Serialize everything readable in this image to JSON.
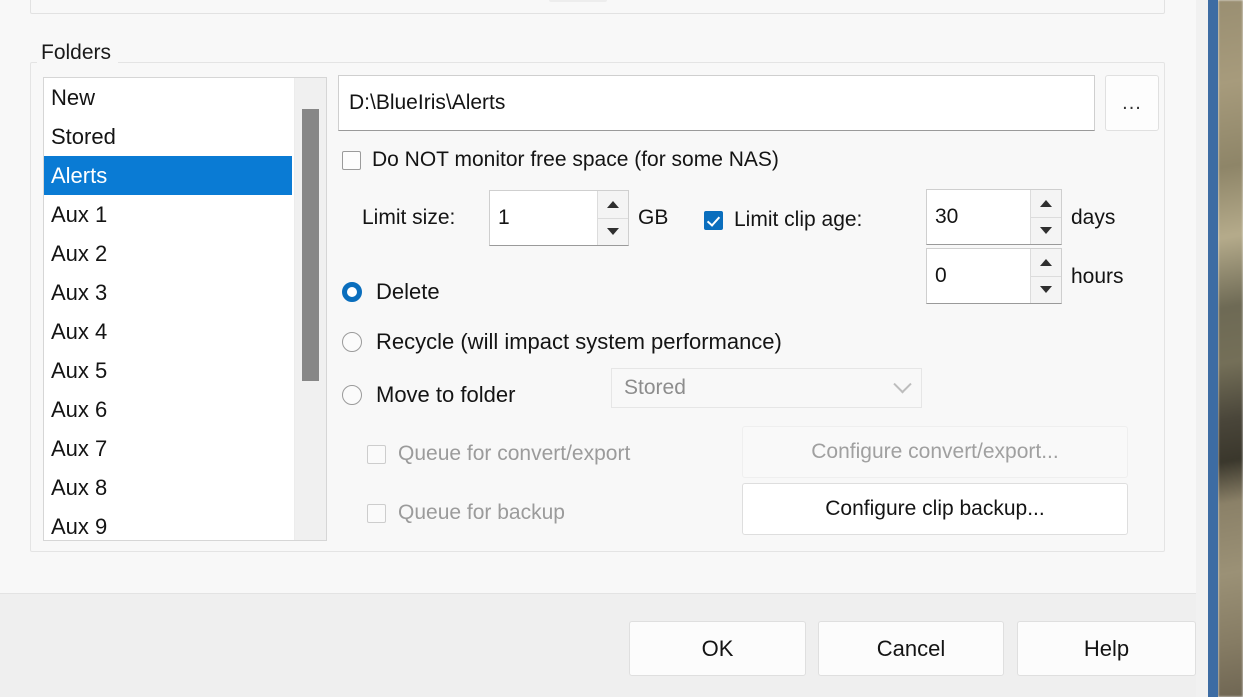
{
  "dialog": {
    "folders_group_label": "Folders"
  },
  "folder_list": {
    "items": [
      {
        "label": "New",
        "selected": false
      },
      {
        "label": "Stored",
        "selected": false
      },
      {
        "label": "Alerts",
        "selected": true
      },
      {
        "label": "Aux 1",
        "selected": false
      },
      {
        "label": "Aux 2",
        "selected": false
      },
      {
        "label": "Aux 3",
        "selected": false
      },
      {
        "label": "Aux 4",
        "selected": false
      },
      {
        "label": "Aux 5",
        "selected": false
      },
      {
        "label": "Aux 6",
        "selected": false
      },
      {
        "label": "Aux 7",
        "selected": false
      },
      {
        "label": "Aux 8",
        "selected": false
      },
      {
        "label": "Aux 9",
        "selected": false
      }
    ],
    "selected_value": "Alerts",
    "selection_color": "#0a7bd4",
    "scrollbar_thumb_color": "#878787"
  },
  "path": {
    "value": "D:\\BlueIris\\Alerts",
    "placeholder": "",
    "browse_label": "..."
  },
  "options": {
    "no_monitor_free_space": {
      "label": "Do NOT monitor free space (for some NAS)",
      "checked": false
    },
    "limit_size": {
      "label": "Limit size:",
      "value": "1",
      "unit": "GB"
    },
    "limit_clip_age": {
      "label": "Limit clip age:",
      "checked": true,
      "days_value": "30",
      "days_unit": "days",
      "hours_value": "0",
      "hours_unit": "hours"
    }
  },
  "disposal": {
    "selected": "Delete",
    "delete_label": "Delete",
    "recycle_label": "Recycle (will impact system performance)",
    "move_label": "Move to folder",
    "move_target": "Stored"
  },
  "queue": {
    "convert_export": {
      "label": "Queue for convert/export",
      "checked": false,
      "enabled": false
    },
    "backup": {
      "label": "Queue for backup",
      "checked": false,
      "enabled": false
    },
    "configure_convert_label": "Configure convert/export...",
    "configure_backup_label": "Configure clip backup..."
  },
  "footer": {
    "ok_label": "OK",
    "cancel_label": "Cancel",
    "help_label": "Help"
  }
}
